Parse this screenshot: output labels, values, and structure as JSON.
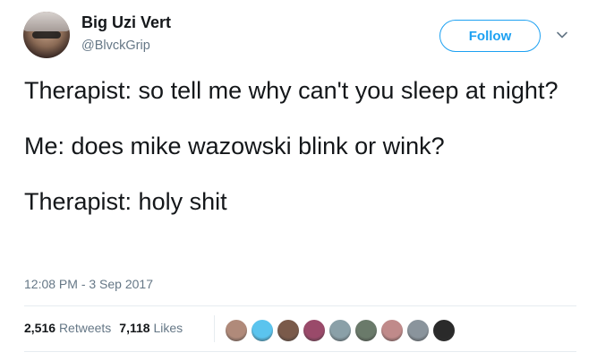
{
  "user": {
    "name": "Big Uzi Vert",
    "handle": "@BlvckGrip"
  },
  "actions": {
    "follow_label": "Follow",
    "menu_icon": "chevron-down-icon"
  },
  "tweet": {
    "lines": [
      "Therapist: so tell me why can't you sleep at night?",
      "Me: does mike wazowski blink or wink?",
      "Therapist: holy shit"
    ],
    "timestamp": "12:08 PM - 3 Sep 2017"
  },
  "stats": {
    "retweets_count": "2,516",
    "retweets_label": "Retweets",
    "likes_count": "7,118",
    "likes_label": "Likes"
  },
  "likers": [
    {
      "color": "#b08a7a"
    },
    {
      "color": "#5bc4ee"
    },
    {
      "color": "#7a5a4a"
    },
    {
      "color": "#9a4a6a"
    },
    {
      "color": "#8aa0a8"
    },
    {
      "color": "#6a7a6a"
    },
    {
      "color": "#c08a8a"
    },
    {
      "color": "#8a949c"
    },
    {
      "color": "#2a2a2a"
    }
  ],
  "colors": {
    "accent": "#1da1f2",
    "text": "#14171a",
    "muted": "#657786",
    "divider": "#e6ecf0"
  }
}
